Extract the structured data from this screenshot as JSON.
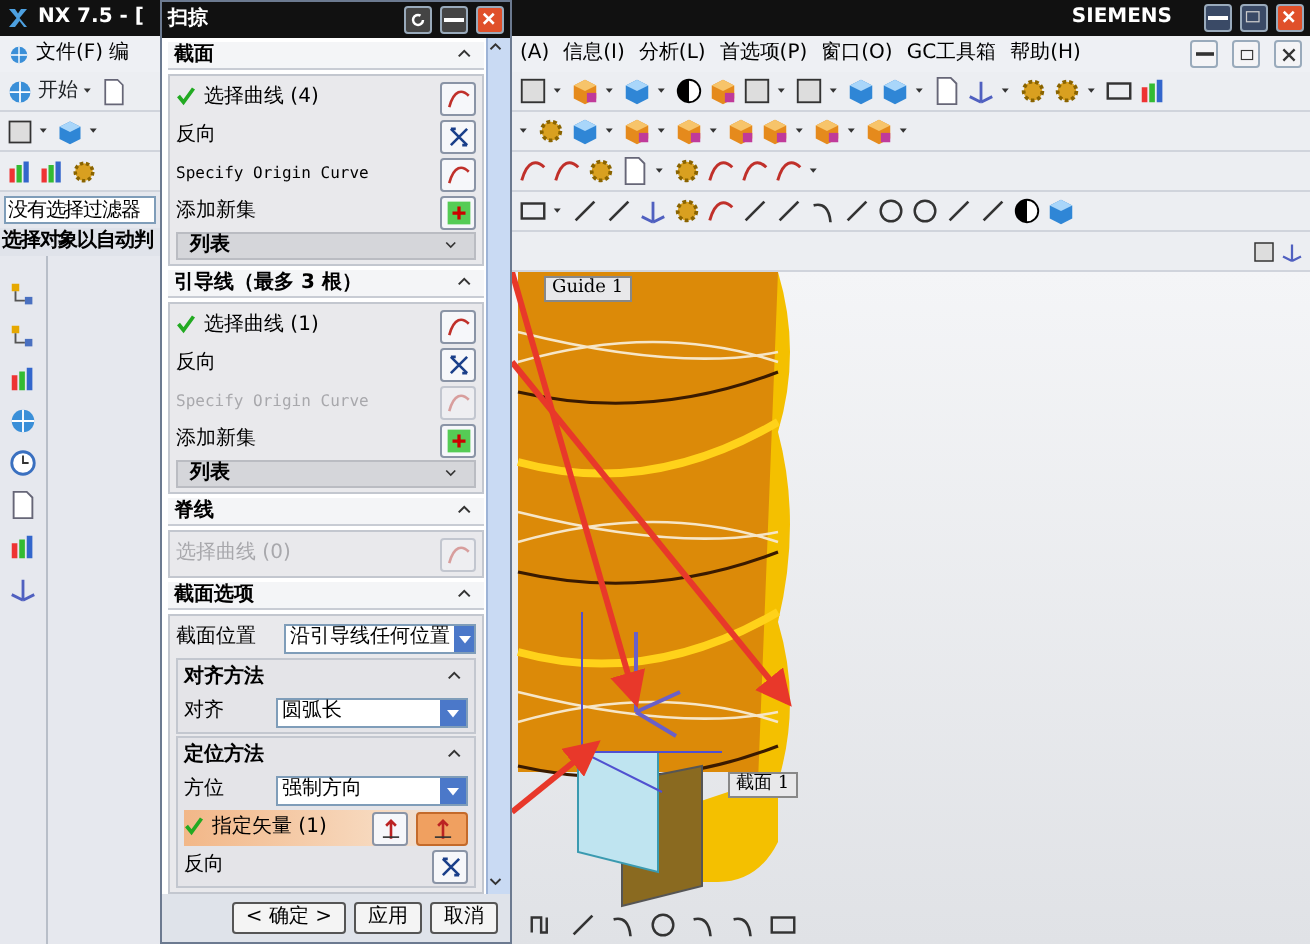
{
  "app_window": {
    "title": "NX 7.5 - [",
    "brand": "SIEMENS"
  },
  "left_menu": [
    "文件(F)",
    "编"
  ],
  "start_button": "开始",
  "selection_filter": {
    "value": "没有选择过滤器"
  },
  "prompt": "选择对象以自动判",
  "right_menu": [
    "(A)",
    "信息(I)",
    "分析(L)",
    "首选项(P)",
    "窗口(O)",
    "GC工具箱",
    "帮助(H)"
  ],
  "dialog": {
    "title": "扫掠",
    "sections": [
      {
        "title": "截面",
        "expanded": true,
        "rows": [
          {
            "kind": "select",
            "label": "选择曲线 (4)",
            "done": true,
            "active": false,
            "disabled": false
          },
          {
            "kind": "reverse",
            "label": "反向",
            "disabled": false
          },
          {
            "kind": "origin",
            "label": "Specify Origin Curve",
            "disabled": false
          },
          {
            "kind": "add",
            "label": "添加新集",
            "disabled": false
          },
          {
            "kind": "list",
            "label": "列表",
            "expanded": false
          }
        ]
      },
      {
        "title": "引导线（最多 3 根）",
        "expanded": true,
        "rows": [
          {
            "kind": "select",
            "label": "选择曲线 (1)",
            "done": true,
            "active": false,
            "disabled": false
          },
          {
            "kind": "reverse",
            "label": "反向",
            "disabled": false
          },
          {
            "kind": "origin",
            "label": "Specify Origin Curve",
            "disabled": true
          },
          {
            "kind": "add",
            "label": "添加新集",
            "disabled": false
          },
          {
            "kind": "list",
            "label": "列表",
            "expanded": false
          }
        ]
      },
      {
        "title": "脊线",
        "expanded": true,
        "rows": [
          {
            "kind": "select",
            "label": "选择曲线 (0)",
            "done": false,
            "active": false,
            "disabled": true
          }
        ]
      },
      {
        "title": "截面选项",
        "expanded": true,
        "rows": [
          {
            "kind": "combo",
            "label": "截面位置",
            "value": "沿引导线任何位置"
          },
          {
            "kind": "group",
            "title": "对齐方法",
            "expanded": true,
            "rows": [
              {
                "kind": "combo",
                "label": "对齐",
                "value": "圆弧长"
              }
            ]
          },
          {
            "kind": "group",
            "title": "定位方法",
            "expanded": true,
            "rows": [
              {
                "kind": "combo",
                "label": "方位",
                "value": "强制方向"
              },
              {
                "kind": "vector",
                "label": "指定矢量 (1)",
                "done": true,
                "active": true,
                "disabled": false
              },
              {
                "kind": "reverse",
                "label": "反向",
                "disabled": false
              }
            ]
          }
        ]
      }
    ],
    "buttons": [
      "< 确定 >",
      "应用",
      "取消"
    ]
  },
  "viewport": {
    "labels": [
      "Guide 1",
      "截面 1"
    ]
  }
}
